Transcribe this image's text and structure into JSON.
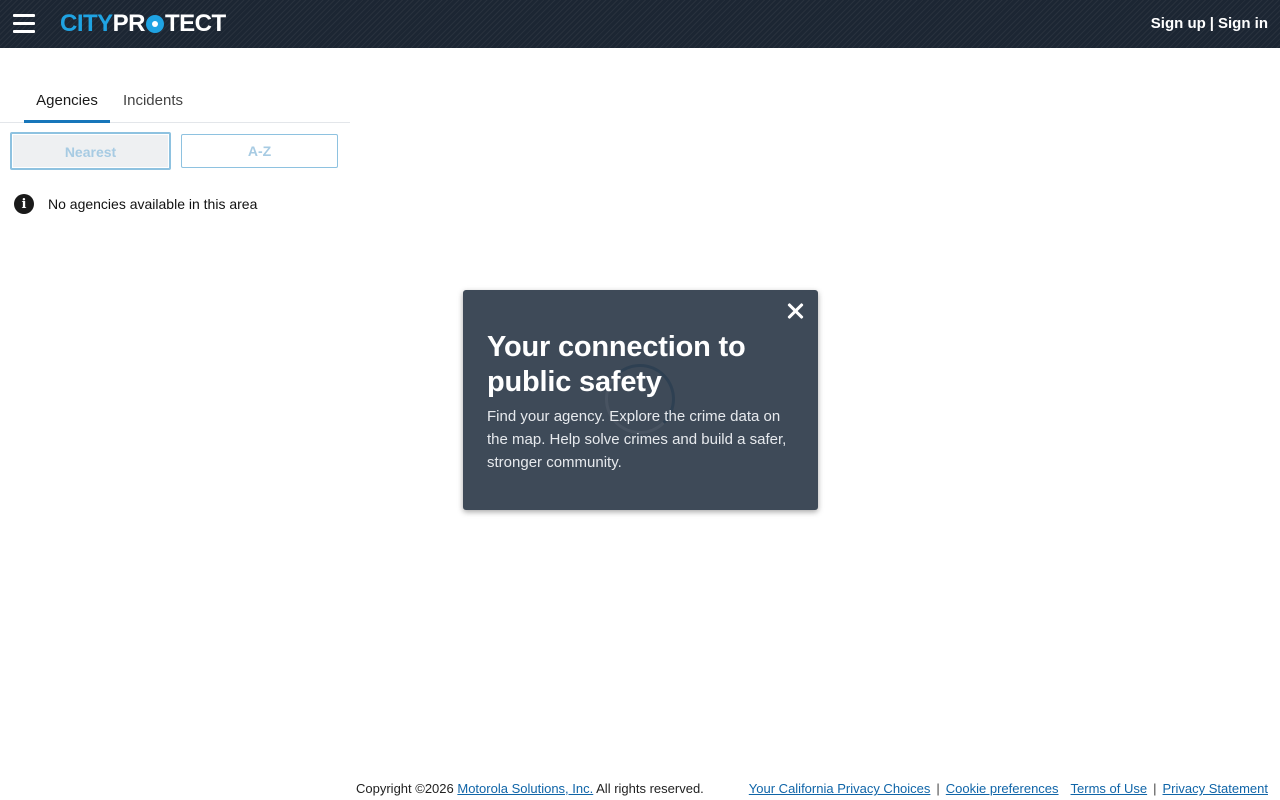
{
  "header": {
    "logo_city": "CITY",
    "logo_pr": "PR",
    "logo_tect": "TECT",
    "sign_up": "Sign up",
    "auth_separator": "|",
    "sign_in": "Sign in"
  },
  "sidebar": {
    "tabs": [
      {
        "label": "Agencies",
        "active": true
      },
      {
        "label": "Incidents",
        "active": false
      }
    ],
    "sort_buttons": [
      {
        "label": "Nearest",
        "selected": true
      },
      {
        "label": "A-Z",
        "selected": false
      }
    ],
    "notice": "No agencies available in this area"
  },
  "modal": {
    "title": "Your connection to public safety",
    "body": "Find your agency. Explore the crime data on the map. Help solve crimes and build a safer, stronger community."
  },
  "footer": {
    "copyright_prefix": "Copyright ©2026",
    "company_link": "Motorola Solutions, Inc.",
    "copyright_suffix": "All rights reserved.",
    "links": [
      "Your California Privacy Choices",
      "Cookie preferences",
      "Terms of Use",
      "Privacy Statement"
    ]
  },
  "colors": {
    "header_bg": "#1c2633",
    "brand_blue": "#1fa3e3",
    "modal_bg": "#3e4a58",
    "link_blue": "#1065a8",
    "active_tab": "#1776ba"
  },
  "icons": [
    "hamburger-menu-icon",
    "info-icon",
    "close-icon",
    "loading-spinner"
  ]
}
